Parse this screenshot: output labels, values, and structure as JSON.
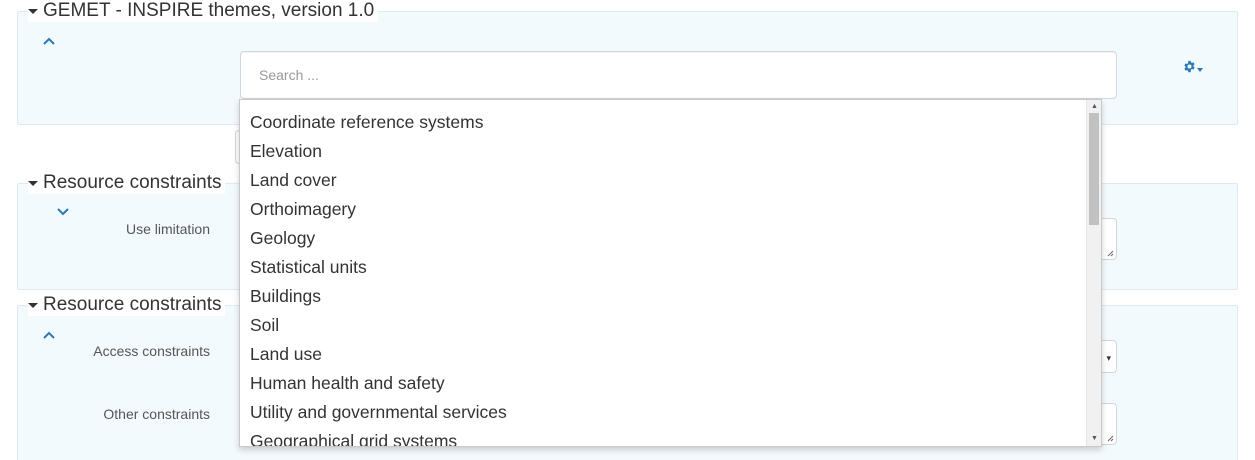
{
  "sections": [
    {
      "title": "GEMET - INSPIRE themes, version 1.0"
    },
    {
      "title": "Resource constraints"
    },
    {
      "title": "Resource constraints"
    }
  ],
  "fields": {
    "use_limitation": "Use limitation",
    "access_constraints": "Access constraints",
    "other_constraints": "Other constraints"
  },
  "search": {
    "placeholder": "Search ..."
  },
  "dropdown": {
    "items": [
      "Coordinate reference systems",
      "Elevation",
      "Land cover",
      "Orthoimagery",
      "Geology",
      "Statistical units",
      "Buildings",
      "Soil",
      "Land use",
      "Human health and safety",
      "Utility and governmental services",
      "Geographical grid systems"
    ],
    "scroll_position": 0.0
  },
  "colors": {
    "accent": "#2a78b5",
    "panel_bg": "#f3fafd",
    "panel_border": "#dfeaf0"
  },
  "icons": {
    "gear": "gear-icon",
    "collapse": "chevron-up-icon",
    "expand": "chevron-down-icon"
  }
}
